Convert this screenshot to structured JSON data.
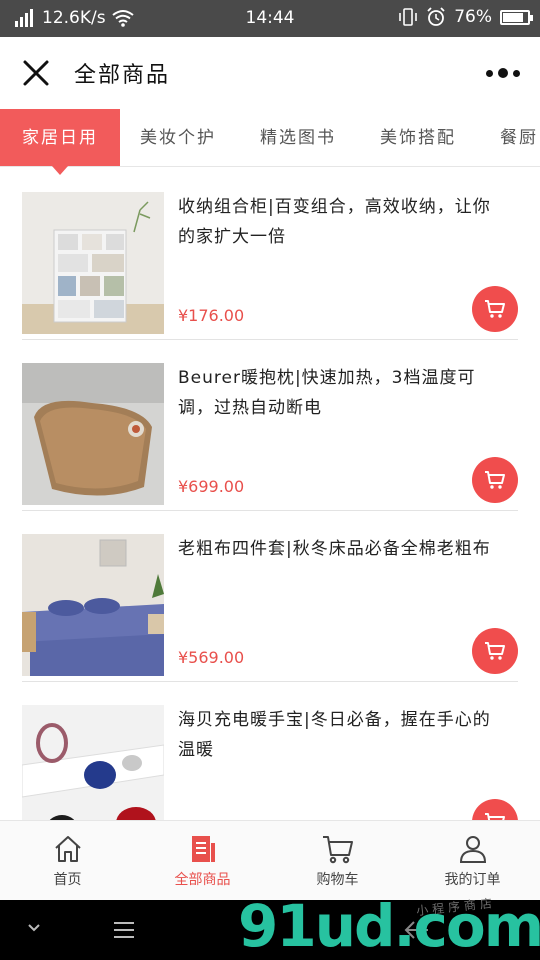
{
  "status_bar": {
    "network_speed": "12.6K/s",
    "time": "14:44",
    "battery": "76%"
  },
  "header": {
    "title": "全部商品"
  },
  "tabs": [
    {
      "label": "家居日用",
      "active": true
    },
    {
      "label": "美妆个护",
      "active": false
    },
    {
      "label": "精选图书",
      "active": false
    },
    {
      "label": "美饰搭配",
      "active": false
    },
    {
      "label": "餐厨",
      "active": false
    }
  ],
  "products": [
    {
      "name": "收纳组合柜|百变组合，高效收纳，让你的家扩大一倍",
      "price": "¥176.00"
    },
    {
      "name": "Beurer暖抱枕|快速加热，3档温度可调，过热自动断电",
      "price": "¥699.00"
    },
    {
      "name": "老粗布四件套|秋冬床品必备全棉老粗布",
      "price": "¥569.00"
    },
    {
      "name": "海贝充电暖手宝|冬日必备，握在手心的温暖",
      "price": ""
    }
  ],
  "bottom_nav": [
    {
      "label": "首页",
      "icon": "home-icon",
      "active": false
    },
    {
      "label": "全部商品",
      "icon": "catalog-icon",
      "active": true
    },
    {
      "label": "购物车",
      "icon": "cart-icon",
      "active": false
    },
    {
      "label": "我的订单",
      "icon": "user-icon",
      "active": false
    }
  ],
  "watermark": {
    "logo": "91ud.com",
    "subtitle": "小程序商店"
  },
  "colors": {
    "accent": "#f25b5b",
    "price": "#e8504c",
    "status_bar": "#4a4a4a"
  }
}
